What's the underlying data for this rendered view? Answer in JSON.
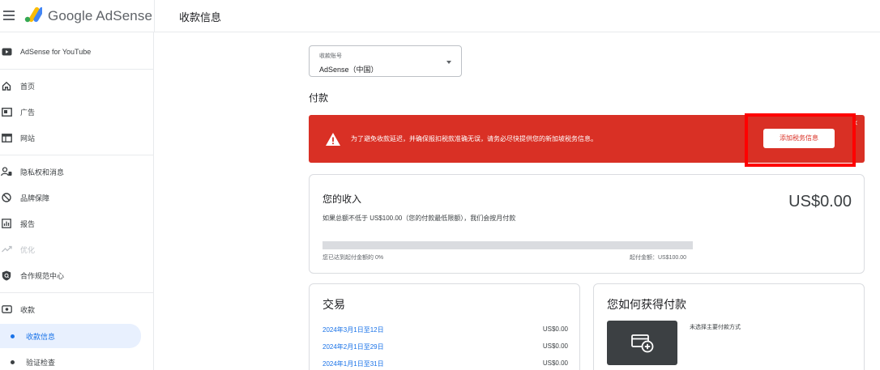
{
  "header": {
    "brand": "Google AdSense",
    "page_title": "收款信息"
  },
  "sidebar": {
    "items": [
      {
        "label": "AdSense for YouTube",
        "icon": "youtube-icon"
      },
      {
        "label": "首页",
        "icon": "home-icon"
      },
      {
        "label": "广告",
        "icon": "ads-icon"
      },
      {
        "label": "网站",
        "icon": "sites-icon"
      },
      {
        "label": "隐私权和消息",
        "icon": "privacy-messaging-icon"
      },
      {
        "label": "品牌保障",
        "icon": "block-icon"
      },
      {
        "label": "报告",
        "icon": "reports-icon"
      },
      {
        "label": "优化",
        "icon": "trending-up-icon"
      },
      {
        "label": "合作规范中心",
        "icon": "policy-shield-icon"
      },
      {
        "label": "收款",
        "icon": "payments-icon"
      },
      {
        "label": "收款信息"
      },
      {
        "label": "验证检查"
      }
    ]
  },
  "main": {
    "account_select": {
      "label": "收款账号",
      "value": "AdSense（中国）"
    },
    "section_title": "付款",
    "alert": {
      "message": "为了避免收款延迟，并确保报扣税款准确无误，请务必尽快提供您的新加坡税务信息。",
      "button": "添加税务信息",
      "close": "✕"
    },
    "income": {
      "title": "您的收入",
      "amount": "US$0.00",
      "description": "如果总额不低于 US$100.00（您的付款最低限额），我们会按月付款",
      "progress_fraction": 0,
      "progress_left": "您已达到起付金额的 0%",
      "progress_right": "起付金额：US$100.00"
    },
    "transactions": {
      "title": "交易",
      "rows": [
        {
          "date": "2024年3月1日至12日",
          "amount": "US$0.00"
        },
        {
          "date": "2024年2月1日至29日",
          "amount": "US$0.00"
        },
        {
          "date": "2024年1月1日至31日",
          "amount": "US$0.00"
        }
      ]
    },
    "payment_method": {
      "title": "您如何获得付款",
      "note": "未选择主要付款方式"
    }
  },
  "colors": {
    "accent": "#1a73e8",
    "alert_red": "#d93025",
    "highlight": "#ff0000"
  }
}
